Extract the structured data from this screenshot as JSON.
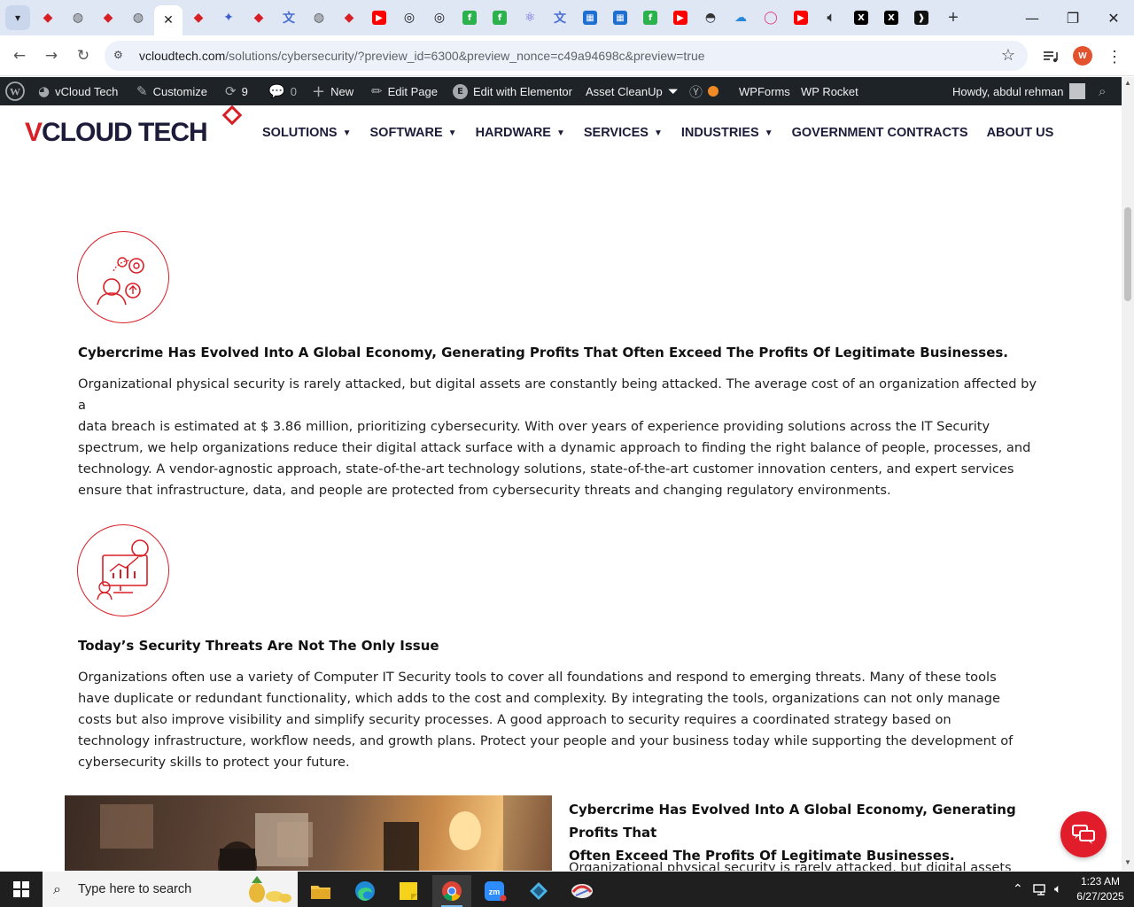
{
  "browser": {
    "tabs": [
      {
        "icon": "gem-icon",
        "color": "#d81f26"
      },
      {
        "icon": "globe-icon",
        "color": "#555555"
      },
      {
        "icon": "gem-icon",
        "color": "#d81f26"
      },
      {
        "icon": "globe-icon",
        "color": "#555555"
      },
      {
        "icon": "close-icon",
        "color": "#222222",
        "active": true
      },
      {
        "icon": "gem-icon",
        "color": "#d81f26"
      },
      {
        "icon": "bird-icon",
        "color": "#3b5ccc"
      },
      {
        "icon": "gem-icon",
        "color": "#d81f26"
      },
      {
        "icon": "translate-icon",
        "color": "#4a6fd1"
      },
      {
        "icon": "globe-icon",
        "color": "#555555"
      },
      {
        "icon": "gem-icon",
        "color": "#d81f26"
      },
      {
        "icon": "youtube-icon",
        "color": "#ff0000"
      },
      {
        "icon": "openai-icon",
        "color": "#111111"
      },
      {
        "icon": "openai-icon",
        "color": "#111111"
      },
      {
        "icon": "feedly-icon",
        "color": "#2bb24c"
      },
      {
        "icon": "feedly-icon",
        "color": "#2bb24c"
      },
      {
        "icon": "atom-icon",
        "color": "#5b5bd6"
      },
      {
        "icon": "translate-icon",
        "color": "#4a6fd1"
      },
      {
        "icon": "grid-icon",
        "color": "#1f6fd1"
      },
      {
        "icon": "grid-icon",
        "color": "#1f6fd1"
      },
      {
        "icon": "feedly-icon",
        "color": "#2bb24c"
      },
      {
        "icon": "youtube-icon",
        "color": "#ff0000"
      },
      {
        "icon": "incognito-icon",
        "color": "#333333"
      },
      {
        "icon": "cloud-icon",
        "color": "#2a88d8"
      },
      {
        "icon": "ring-icon",
        "color": "#e0457b"
      },
      {
        "icon": "youtube-icon",
        "color": "#ff0000"
      },
      {
        "icon": "speaker-icon",
        "color": "#333333"
      },
      {
        "icon": "x-icon",
        "color": "#000000"
      },
      {
        "icon": "x-icon",
        "color": "#000000"
      },
      {
        "icon": "code-icon",
        "color": "#111111"
      }
    ],
    "url_host": "vcloudtech.com",
    "url_path": "/solutions/cybersecurity/?preview_id=6300&preview_nonce=c49a94698c&preview=true",
    "profile_initial": "W"
  },
  "adminbar": {
    "site_name": "vCloud Tech",
    "customize": "Customize",
    "updates_count": "9",
    "comments_count": "0",
    "new": "New",
    "edit_page": "Edit Page",
    "edit_elementor": "Edit with Elementor",
    "asset_cleanup": "Asset CleanUp",
    "wpforms": "WPForms",
    "wp_rocket": "WP Rocket",
    "howdy": "Howdy, abdul rehman"
  },
  "site": {
    "logo_v": "V",
    "logo_rest": "CLOUD TECH",
    "nav": [
      {
        "label": "SOLUTIONS",
        "dropdown": true
      },
      {
        "label": "SOFTWARE",
        "dropdown": true
      },
      {
        "label": "HARDWARE",
        "dropdown": true
      },
      {
        "label": "SERVICES",
        "dropdown": true
      },
      {
        "label": "INDUSTRIES",
        "dropdown": true
      },
      {
        "label": "GOVERNMENT CONTRACTS",
        "dropdown": false
      },
      {
        "label": "ABOUT US",
        "dropdown": false
      }
    ],
    "accent_color": "#d81f26"
  },
  "sections": [
    {
      "heading": "Cybercrime Has Evolved Into A Global Economy, Generating Profits That Often Exceed The Profits Of Legitimate Businesses.",
      "lines": [
        "Organizational physical security is rarely attacked, but digital assets are constantly being attacked. The average cost of an organization affected by a",
        "data breach is estimated at $ 3.86 million, prioritizing cybersecurity. With over years of experience providing solutions across the IT Security",
        "spectrum, we help organizations reduce their digital attack surface with a dynamic approach to finding the right balance of people, processes, and",
        "technology. A vendor-agnostic approach, state-of-the-art technology solutions, state-of-the-art customer innovation centers, and expert services",
        "ensure that infrastructure, data, and people are protected from cybersecurity threats and changing regulatory environments."
      ]
    },
    {
      "heading": "Today’s Security Threats Are Not The Only Issue",
      "lines": [
        "Organizations often use a variety of Computer IT Security tools to cover all foundations and respond to emerging threats. Many of these tools",
        "have duplicate or redundant functionality, which adds to the cost and complexity. By integrating the tools, organizations can not only manage",
        "costs but also improve visibility and simplify security processes. A good approach to security requires a coordinated strategy based on",
        "technology infrastructure, workflow needs, and growth plans. Protect your people and your business today while supporting the development of",
        "cybersecurity skills to protect your future."
      ]
    }
  ],
  "bottom": {
    "heading_line1": "Cybercrime Has Evolved Into A Global Economy, Generating Profits That",
    "heading_line2": "Often Exceed The Profits Of Legitimate Businesses.",
    "para_start": "Organizational physical security is rarely attacked, but digital assets"
  },
  "taskbar": {
    "search_placeholder": "Type here to search",
    "time": "1:23 AM",
    "date": "6/27/2025"
  }
}
